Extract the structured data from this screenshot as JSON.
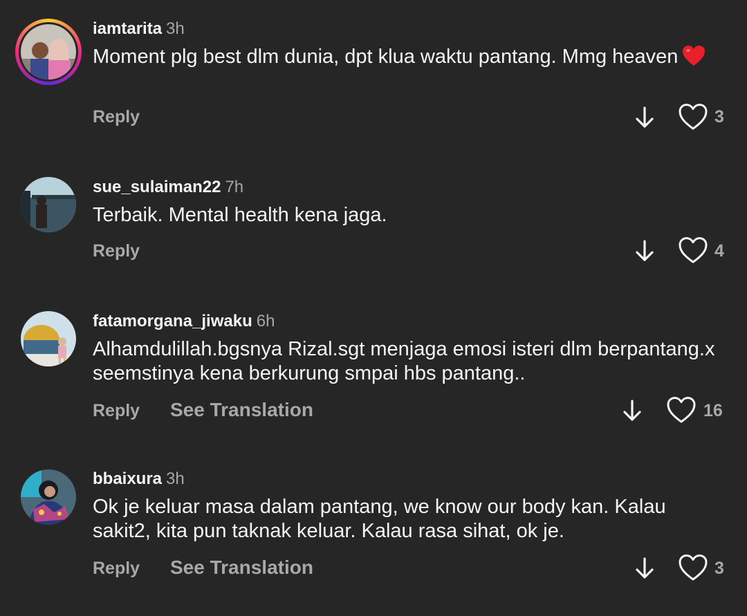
{
  "comments": [
    {
      "username": "iamtarita",
      "time": "3h",
      "text": "Moment plg best dlm dunia, dpt klua waktu pantang. Mmg heaven",
      "emoji": "red-heart",
      "reply_label": "Reply",
      "likes": "3",
      "has_story_ring": true
    },
    {
      "username": "sue_sulaiman22",
      "time": "7h",
      "text": "Terbaik. Mental health kena jaga.",
      "reply_label": "Reply",
      "likes": "4"
    },
    {
      "username": "fatamorgana_jiwaku",
      "time": "6h",
      "text": "Alhamdulillah.bgsnya Rizal.sgt menjaga emosi isteri dlm berpantang.x seemstinya kena berkurung smpai hbs pantang..",
      "reply_label": "Reply",
      "translation_label": "See Translation",
      "likes": "16"
    },
    {
      "username": "bbaixura",
      "time": "3h",
      "text": "Ok je keluar masa dalam pantang, we know our body kan. Kalau sakit2, kita pun taknak keluar. Kalau rasa sihat, ok je.",
      "reply_label": "Reply",
      "translation_label": "See Translation",
      "likes": "3"
    }
  ],
  "colors": {
    "background": "#262626",
    "primary_text": "#f5f5f5",
    "secondary_text": "#a8a8a8",
    "heart_emoji": "#e8202a"
  }
}
